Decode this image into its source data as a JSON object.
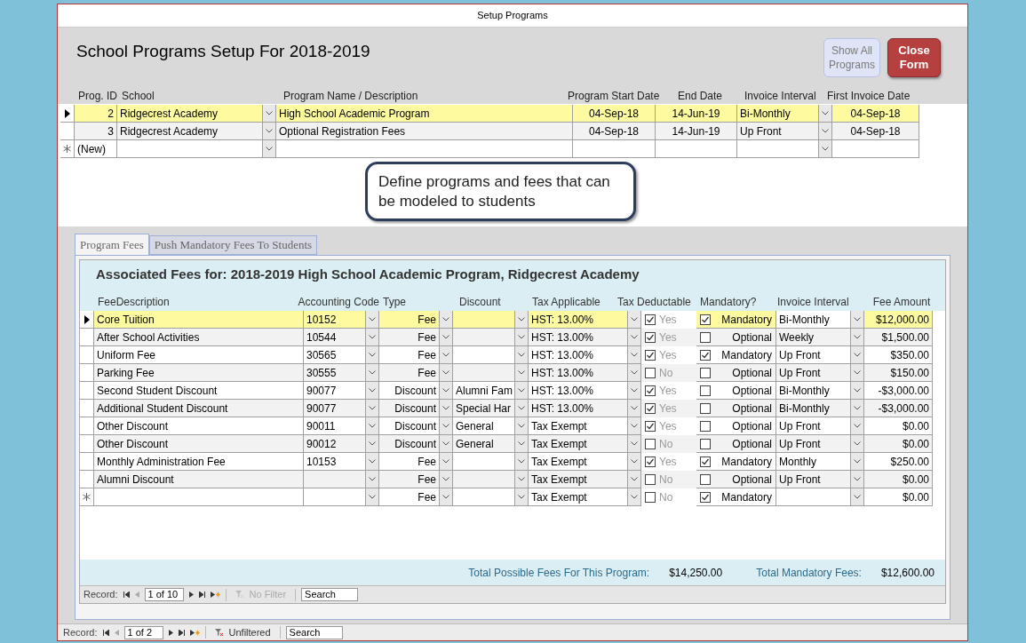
{
  "window": {
    "title": "Setup Programs"
  },
  "form": {
    "title": "School Programs Setup For 2018-2019",
    "buttons": [
      {
        "label": "Show All Programs",
        "kind": "secondary"
      },
      {
        "label": "Close Form",
        "kind": "primary"
      }
    ]
  },
  "programs": {
    "columns": [
      "Prog. ID",
      "School",
      "Program Name / Description",
      "Program Start Date",
      "End Date",
      "Invoice Interval",
      "First Invoice Date"
    ],
    "rows": [
      {
        "kind": "record",
        "selected": true,
        "id": "2",
        "school": "Ridgecrest Academy",
        "name": "High School Academic Program",
        "start": "04-Sep-18",
        "end": "14-Jun-19",
        "interval": "Bi-Monthly",
        "first_invoice": "04-Sep-18"
      },
      {
        "kind": "record",
        "selected": false,
        "id": "3",
        "school": "Ridgecrest Academy",
        "name": "Optional Registration Fees",
        "start": "04-Sep-18",
        "end": "14-Jun-19",
        "interval": "Up Front",
        "first_invoice": "04-Sep-18"
      },
      {
        "kind": "new",
        "selected": false,
        "id": "(New)",
        "school": "",
        "name": "",
        "start": "",
        "end": "",
        "interval": "",
        "first_invoice": ""
      }
    ]
  },
  "callout": "Define programs and fees that can be modeled to students",
  "tabs": [
    {
      "label": "Program Fees",
      "selected": true
    },
    {
      "label": "Push Mandatory Fees To Students",
      "selected": false
    }
  ],
  "fees": {
    "title": "Associated Fees for: 2018-2019 High School Academic Program, Ridgecrest Academy",
    "columns": [
      "FeeDescription",
      "Accounting Code",
      "Type",
      "Discount",
      "Tax Applicable",
      "Tax Deductable",
      "Mandatory?",
      "Invoice Interval",
      "Fee Amount"
    ],
    "rows": [
      {
        "kind": "record",
        "selected": true,
        "description": "Core Tuition",
        "code": "10152",
        "type": "Fee",
        "discount": "",
        "tax": "HST: 13.00%",
        "deductible": true,
        "deductible_label": "Yes",
        "mandatory": true,
        "mandatory_label": "Mandatory",
        "interval": "Bi-Monthly",
        "amount": "$12,000.00"
      },
      {
        "kind": "record",
        "selected": false,
        "description": "After School Activities",
        "code": "10544",
        "type": "Fee",
        "discount": "",
        "tax": "HST: 13.00%",
        "deductible": true,
        "deductible_label": "Yes",
        "mandatory": false,
        "mandatory_label": "Optional",
        "interval": "Weekly",
        "amount": "$1,500.00"
      },
      {
        "kind": "record",
        "selected": false,
        "description": "Uniform Fee",
        "code": "30565",
        "type": "Fee",
        "discount": "",
        "tax": "HST: 13.00%",
        "deductible": true,
        "deductible_label": "Yes",
        "mandatory": true,
        "mandatory_label": "Mandatory",
        "interval": "Up Front",
        "amount": "$350.00"
      },
      {
        "kind": "record",
        "selected": false,
        "description": "Parking Fee",
        "code": "30555",
        "type": "Fee",
        "discount": "",
        "tax": "HST: 13.00%",
        "deductible": false,
        "deductible_label": "No",
        "mandatory": false,
        "mandatory_label": "Optional",
        "interval": "Up Front",
        "amount": "$150.00"
      },
      {
        "kind": "record",
        "selected": false,
        "description": "Second Student Discount",
        "code": "90077",
        "type": "Discount",
        "discount": "Alumni Fam",
        "tax": "HST: 13.00%",
        "deductible": true,
        "deductible_label": "Yes",
        "mandatory": false,
        "mandatory_label": "Optional",
        "interval": "Bi-Monthly",
        "amount": "-$3,000.00"
      },
      {
        "kind": "record",
        "selected": false,
        "description": "Additional Student Discount",
        "code": "90077",
        "type": "Discount",
        "discount": "Special Har",
        "tax": "HST: 13.00%",
        "deductible": true,
        "deductible_label": "Yes",
        "mandatory": false,
        "mandatory_label": "Optional",
        "interval": "Bi-Monthly",
        "amount": "-$3,000.00"
      },
      {
        "kind": "record",
        "selected": false,
        "description": "Other Discount",
        "code": "90011",
        "type": "Discount",
        "discount": "General",
        "tax": "Tax Exempt",
        "deductible": true,
        "deductible_label": "Yes",
        "mandatory": false,
        "mandatory_label": "Optional",
        "interval": "Up Front",
        "amount": "$0.00"
      },
      {
        "kind": "record",
        "selected": false,
        "description": "Other Discount",
        "code": "90012",
        "type": "Discount",
        "discount": "General",
        "tax": "Tax Exempt",
        "deductible": false,
        "deductible_label": "No",
        "mandatory": false,
        "mandatory_label": "Optional",
        "interval": "Up Front",
        "amount": "$0.00"
      },
      {
        "kind": "record",
        "selected": false,
        "description": "Monthly Administration Fee",
        "code": "10153",
        "type": "Fee",
        "discount": "",
        "tax": "Tax Exempt",
        "deductible": true,
        "deductible_label": "Yes",
        "mandatory": true,
        "mandatory_label": "Mandatory",
        "interval": "Monthly",
        "amount": "$250.00"
      },
      {
        "kind": "record",
        "selected": false,
        "description": "Alumni Discount",
        "code": "",
        "type": "Fee",
        "discount": "",
        "tax": "Tax Exempt",
        "deductible": false,
        "deductible_label": "No",
        "mandatory": false,
        "mandatory_label": "Optional",
        "interval": "Up Front",
        "amount": "$0.00"
      },
      {
        "kind": "new",
        "selected": false,
        "description": "",
        "code": "",
        "type": "Fee",
        "discount": "",
        "tax": "Tax Exempt",
        "deductible": false,
        "deductible_label": "No",
        "mandatory": true,
        "mandatory_label": "Mandatory",
        "interval": "",
        "amount": "$0.00"
      }
    ],
    "totals": [
      {
        "label": "Total Possible Fees For This Program:",
        "value": "$14,250.00"
      },
      {
        "label": "Total Mandatory Fees:",
        "value": "$12,600.00"
      }
    ],
    "navigator": {
      "label": "Record:",
      "position": "1 of 10",
      "filter": "No Filter",
      "filter_active": false,
      "search_placeholder": "Search"
    }
  },
  "navigator": {
    "label": "Record:",
    "position": "1 of 2",
    "filter": "Unfiltered",
    "filter_active": true,
    "search_placeholder": "Search"
  }
}
